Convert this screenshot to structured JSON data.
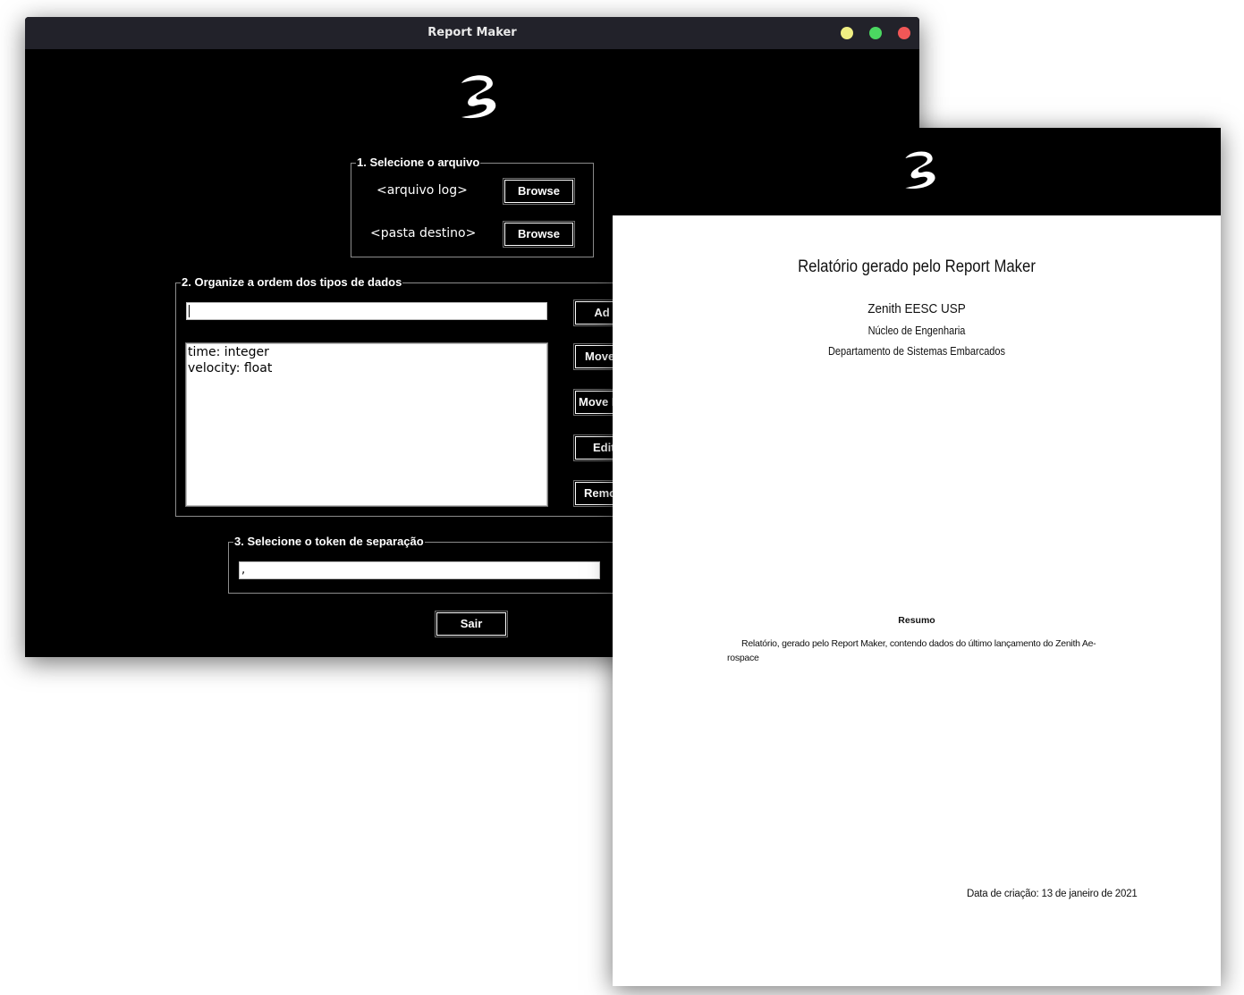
{
  "window": {
    "title": "Report Maker",
    "controls": [
      {
        "name": "minimize",
        "color": "#f0ef83"
      },
      {
        "name": "maximize",
        "color": "#4bd861"
      },
      {
        "name": "close",
        "color": "#f25757"
      }
    ]
  },
  "app": {
    "logo_icon": "zenith-logo-icon",
    "section1": {
      "legend": "1. Selecione o arquivo",
      "log_file_label": "<arquivo log>",
      "dest_folder_label": "<pasta destino>",
      "browse_label": "Browse"
    },
    "section2": {
      "legend": "2. Organize a ordem dos tipos de dados",
      "entry_value": "",
      "items": [
        "time: integer",
        "velocity: float"
      ],
      "buttons": {
        "add": "Ad",
        "move_up": "Move",
        "move_down": "Move D",
        "edit": "Edit",
        "remove": "Remo"
      }
    },
    "section3": {
      "legend": "3. Selecione o token de separação",
      "token_value": ","
    },
    "exit_label": "Sair"
  },
  "pdf": {
    "logo_icon": "zenith-logo-icon",
    "title": "Relatório gerado pelo Report Maker",
    "org": "Zenith EESC USP",
    "nucleo": "Núcleo de Engenharia",
    "departamento": "Departamento de Sistemas Embarcados",
    "resumo_heading": "Resumo",
    "resumo_text": "Relatório, gerado pelo Report Maker, contendo dados do último lançamento do Zenith Ae-rospace",
    "date_text": "Data de criação: 13 de janeiro de 2021"
  }
}
